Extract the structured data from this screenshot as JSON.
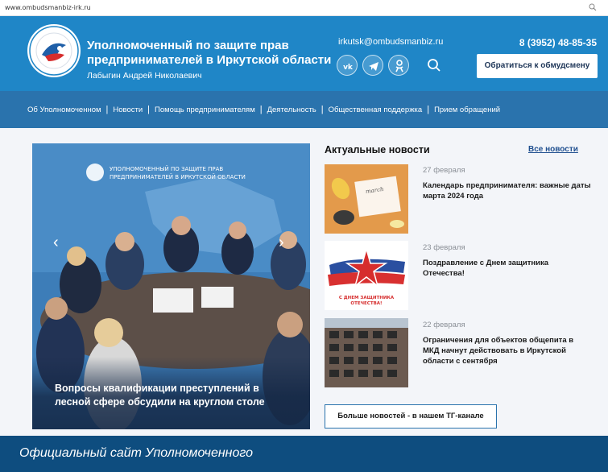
{
  "browser": {
    "url": "www.ombudsmanbiz-irk.ru"
  },
  "header": {
    "title_line1": "Уполномоченный по защите прав",
    "title_line2": "предпринимателей в Иркутской области",
    "person": "Лабыгин Андрей Николаевич",
    "email": "irkutsk@ombudsmanbiz.ru",
    "phone": "8 (3952) 48-85-35",
    "contact_button": "Обратиться к обмудсмену",
    "social_icons": [
      "vk-icon",
      "telegram-icon",
      "odnoklassniki-icon"
    ]
  },
  "nav": {
    "items": [
      "Об Уполномоченном",
      "Новости",
      "Помощь предпринимателям",
      "Деятельность",
      "Общественная поддержка",
      "Прием обращений"
    ]
  },
  "hero": {
    "slide_title": "Вопросы квалификации преступлений в лесной сфере обсудили на круглом столе",
    "banner_line1": "УПОЛНОМОЧЕННЫЙ ПО ЗАЩИТЕ ПРАВ",
    "banner_line2": "ПРЕДПРИНИМАТЕЛЕЙ В ИРКУТСКОЙ ОБЛАСТИ"
  },
  "news": {
    "heading": "Актуальные новости",
    "all_link": "Все новости",
    "items": [
      {
        "date": "27 февраля",
        "title": "Календарь предпринимателя: важные даты марта 2024 года"
      },
      {
        "date": "23 февраля",
        "title": "Поздравление с Днем защитника Отечества!",
        "thumb_text_1": "С ДНЕМ ЗАЩИТНИКА",
        "thumb_text_2": "ОТЕЧЕСТВА!"
      },
      {
        "date": "22 февраля",
        "title": "Ограничения для объектов общепита в МКД начнут действовать в Иркутской области с сентября"
      }
    ],
    "tg_button": "Больше новостей - в нашем ТГ-канале"
  },
  "caption": {
    "text": "Официальный сайт Уполномоченного"
  },
  "colors": {
    "header": "#1f86c7",
    "nav": "#2a73ad",
    "footer": "#0e4d7f"
  }
}
